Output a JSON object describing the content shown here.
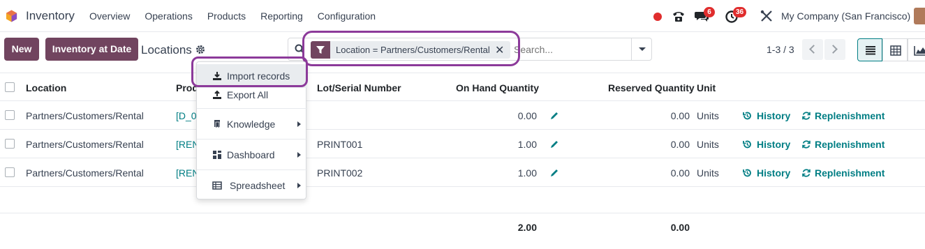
{
  "navbar": {
    "app_name": "Inventory",
    "menu": [
      "Overview",
      "Operations",
      "Products",
      "Reporting",
      "Configuration"
    ],
    "messages_count": "6",
    "activities_count": "36",
    "company": "My Company (San Francisco)"
  },
  "control_panel": {
    "new_label": "New",
    "inventory_at_date_label": "Inventory at Date",
    "breadcrumb": "Locations",
    "facet_text": "Location = Partners/Customers/Rental",
    "search_placeholder": "Search...",
    "pager": "1-3 / 3"
  },
  "table": {
    "headers": {
      "location": "Location",
      "product": "Prod",
      "lot": "Lot/Serial Number",
      "on_hand": "On Hand Quantity",
      "reserved": "Reserved Quantity",
      "unit": "Unit"
    },
    "rows": [
      {
        "location": "Partners/Customers/Rental",
        "product": "[D_0",
        "lot": "",
        "on_hand": "0.00",
        "reserved": "0.00",
        "unit": "Units",
        "history": "History",
        "replenishment": "Replenishment"
      },
      {
        "location": "Partners/Customers/Rental",
        "product": "[REN",
        "lot": "PRINT001",
        "on_hand": "1.00",
        "reserved": "0.00",
        "unit": "Units",
        "history": "History",
        "replenishment": "Replenishment"
      },
      {
        "location": "Partners/Customers/Rental",
        "product": "[REN",
        "lot": "PRINT002",
        "on_hand": "1.00",
        "reserved": "0.00",
        "unit": "Units",
        "history": "History",
        "replenishment": "Replenishment"
      }
    ],
    "totals": {
      "on_hand": "2.00",
      "reserved": "0.00"
    }
  },
  "dropdown": {
    "items": [
      "Import records",
      "Export All",
      "Knowledge",
      "Dashboard",
      "Spreadsheet"
    ]
  },
  "colors": {
    "brand": "#71445f",
    "accent": "#017e84",
    "annotation": "#8c3a9a",
    "badge": "#e02d2d"
  }
}
